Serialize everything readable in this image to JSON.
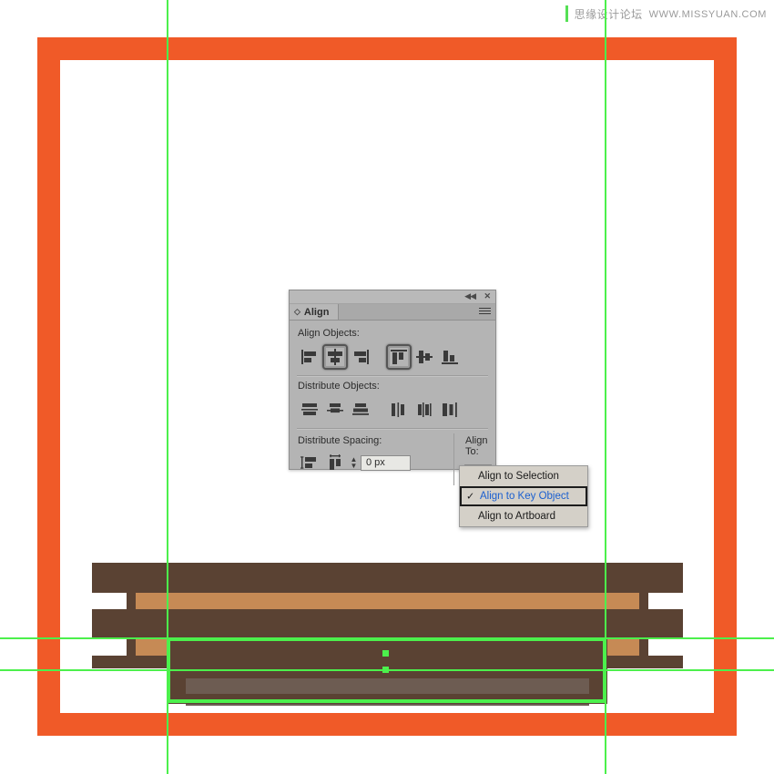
{
  "watermark": {
    "cn": "思缘设计论坛",
    "en": "WWW.MISSYUAN.COM"
  },
  "panel": {
    "tab_label": "Align",
    "collapse_icon": "◀◀",
    "close_icon": "✕",
    "menu_icon": "panel-menu-icon",
    "sections": {
      "align_objects_label": "Align Objects:",
      "distribute_objects_label": "Distribute Objects:",
      "distribute_spacing_label": "Distribute Spacing:",
      "align_to_label": "Align To:"
    },
    "align_objects_buttons": [
      {
        "name": "horizontal-align-left",
        "active": false
      },
      {
        "name": "horizontal-align-center",
        "active": true
      },
      {
        "name": "horizontal-align-right",
        "active": false
      },
      {
        "name": "vertical-align-top",
        "active": true
      },
      {
        "name": "vertical-align-center",
        "active": false
      },
      {
        "name": "vertical-align-bottom",
        "active": false
      }
    ],
    "distribute_objects_buttons": [
      {
        "name": "vertical-distribute-top",
        "active": false
      },
      {
        "name": "vertical-distribute-center",
        "active": false
      },
      {
        "name": "vertical-distribute-bottom",
        "active": false
      },
      {
        "name": "horizontal-distribute-left",
        "active": false
      },
      {
        "name": "horizontal-distribute-center",
        "active": false
      },
      {
        "name": "horizontal-distribute-right",
        "active": false
      }
    ],
    "distribute_spacing_buttons": [
      {
        "name": "vertical-distribute-spacing",
        "active": false
      },
      {
        "name": "horizontal-distribute-spacing",
        "active": false
      }
    ],
    "spacing_value": "0 px",
    "spacing_placeholder": "0 px",
    "align_to_selected_icon": "align-to-key-object-icon",
    "chevron": "⌄"
  },
  "dropdown": {
    "items": [
      {
        "label": "Align to Selection",
        "selected": false
      },
      {
        "label": "Align to Key Object",
        "selected": true
      },
      {
        "label": "Align to Artboard",
        "selected": false
      }
    ],
    "check_glyph": "✓"
  },
  "colors": {
    "frame_orange": "#f05a28",
    "bench_dark": "#5a4233",
    "bench_light": "#c68a55",
    "bench_shadow": "#6d5c52",
    "guide_green": "#4cf04c",
    "panel_gray": "#b4b4b4",
    "selected_text_blue": "#1a5fd0"
  },
  "artwork": {
    "title": "wooden-bench-illustration"
  }
}
